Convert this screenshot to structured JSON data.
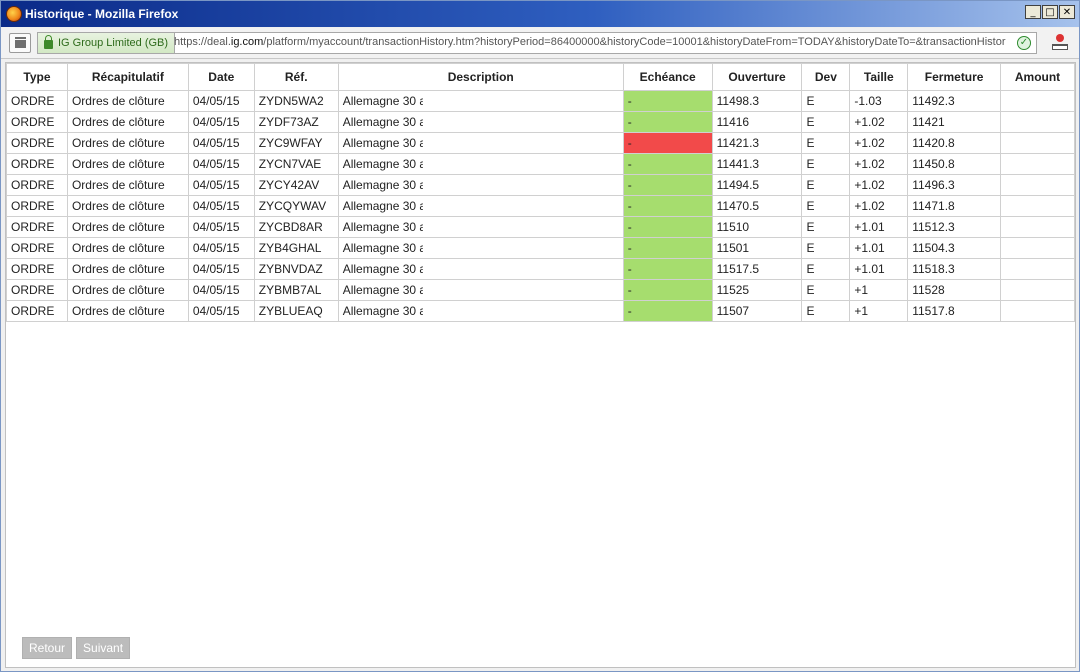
{
  "window": {
    "title": "Historique - Mozilla Firefox",
    "controls": {
      "minimize": "_",
      "maximize": "□",
      "close": "✕"
    }
  },
  "urlbar": {
    "identity": "IG Group Limited (GB)",
    "url_prefix": "https://deal.",
    "url_domain": "ig.com",
    "url_rest": "/platform/myaccount/transactionHistory.htm?historyPeriod=86400000&historyCode=10001&historyDateFrom=TODAY&historyDateTo=&transactionHistor"
  },
  "table": {
    "headers": [
      "Type",
      "Récapitulatif",
      "Date",
      "Réf.",
      "Description",
      "Echéance",
      "Ouverture",
      "Dev",
      "Taille",
      "Fermeture",
      "Amount"
    ],
    "rows": [
      {
        "type": "ORDRE",
        "recap": "Ordres de clôture",
        "date": "04/05/15",
        "ref": "ZYDN5WA2",
        "desc": "Allemagne 30 a",
        "ech": "-",
        "ech_status": "green",
        "ouv": "11498.3",
        "dev": "E",
        "taille": "-1.03",
        "ferm": "11492.3"
      },
      {
        "type": "ORDRE",
        "recap": "Ordres de clôture",
        "date": "04/05/15",
        "ref": "ZYDF73AZ",
        "desc": "Allemagne 30 a",
        "ech": "-",
        "ech_status": "green",
        "ouv": "11416",
        "dev": "E",
        "taille": "+1.02",
        "ferm": "11421"
      },
      {
        "type": "ORDRE",
        "recap": "Ordres de clôture",
        "date": "04/05/15",
        "ref": "ZYC9WFAY",
        "desc": "Allemagne 30 a",
        "ech": "-",
        "ech_status": "red",
        "ouv": "11421.3",
        "dev": "E",
        "taille": "+1.02",
        "ferm": "11420.8"
      },
      {
        "type": "ORDRE",
        "recap": "Ordres de clôture",
        "date": "04/05/15",
        "ref": "ZYCN7VAE",
        "desc": "Allemagne 30 a",
        "ech": "-",
        "ech_status": "green",
        "ouv": "11441.3",
        "dev": "E",
        "taille": "+1.02",
        "ferm": "11450.8"
      },
      {
        "type": "ORDRE",
        "recap": "Ordres de clôture",
        "date": "04/05/15",
        "ref": "ZYCY42AV",
        "desc": "Allemagne 30 a",
        "ech": "-",
        "ech_status": "green",
        "ouv": "11494.5",
        "dev": "E",
        "taille": "+1.02",
        "ferm": "11496.3"
      },
      {
        "type": "ORDRE",
        "recap": "Ordres de clôture",
        "date": "04/05/15",
        "ref": "ZYCQYWAV",
        "desc": "Allemagne 30 a",
        "ech": "-",
        "ech_status": "green",
        "ouv": "11470.5",
        "dev": "E",
        "taille": "+1.02",
        "ferm": "11471.8"
      },
      {
        "type": "ORDRE",
        "recap": "Ordres de clôture",
        "date": "04/05/15",
        "ref": "ZYCBD8AR",
        "desc": "Allemagne 30 a",
        "ech": "-",
        "ech_status": "green",
        "ouv": "11510",
        "dev": "E",
        "taille": "+1.01",
        "ferm": "11512.3"
      },
      {
        "type": "ORDRE",
        "recap": "Ordres de clôture",
        "date": "04/05/15",
        "ref": "ZYB4GHAL",
        "desc": "Allemagne 30 a",
        "ech": "-",
        "ech_status": "green",
        "ouv": "11501",
        "dev": "E",
        "taille": "+1.01",
        "ferm": "11504.3"
      },
      {
        "type": "ORDRE",
        "recap": "Ordres de clôture",
        "date": "04/05/15",
        "ref": "ZYBNVDAZ",
        "desc": "Allemagne 30 a",
        "ech": "-",
        "ech_status": "green",
        "ouv": "11517.5",
        "dev": "E",
        "taille": "+1.01",
        "ferm": "11518.3"
      },
      {
        "type": "ORDRE",
        "recap": "Ordres de clôture",
        "date": "04/05/15",
        "ref": "ZYBMB7AL",
        "desc": "Allemagne 30 a",
        "ech": "-",
        "ech_status": "green",
        "ouv": "11525",
        "dev": "E",
        "taille": "+1",
        "ferm": "11528"
      },
      {
        "type": "ORDRE",
        "recap": "Ordres de clôture",
        "date": "04/05/15",
        "ref": "ZYBLUEAQ",
        "desc": "Allemagne 30 a",
        "ech": "-",
        "ech_status": "green",
        "ouv": "11507",
        "dev": "E",
        "taille": "+1",
        "ferm": "11517.8"
      }
    ]
  },
  "pager": {
    "prev": "Retour",
    "next": "Suivant"
  },
  "colors": {
    "echeance_green": "#a6dd6e",
    "echeance_red": "#f24a4a",
    "title_bar": "#0a2a88"
  }
}
